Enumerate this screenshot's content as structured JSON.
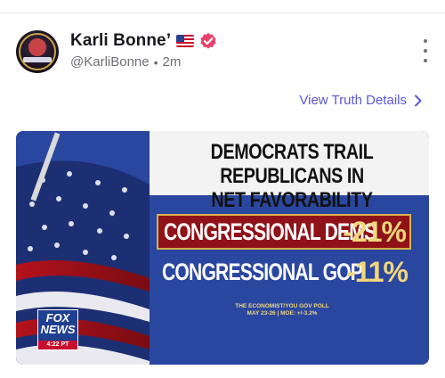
{
  "post": {
    "author_name": "Karli Bonne’",
    "handle": "@KarliBonne",
    "separator": "•",
    "timestamp": "2m",
    "details_link": "View Truth Details"
  },
  "graphic": {
    "headline_line1": "DEMOCRATS TRAIL REPUBLICANS IN",
    "headline_line2": "NET FAVORABILITY",
    "rows": [
      {
        "label": "CONGRESSIONAL DEMS",
        "value": "-21%"
      },
      {
        "label": "CONGRESSIONAL GOP",
        "value": "-11%"
      }
    ],
    "source_line1": "THE ECONOMIST/YOU GOV POLL",
    "source_line2": "MAY 23-26 | MOE: +/-3.2%",
    "network_line1": "FOX",
    "network_line2": "NEWS",
    "network_time": "4:22 PT"
  },
  "colors": {
    "link": "#5b58d6",
    "verified_badge": "#e8436b",
    "dems_bar": "#8f1218",
    "value_gold": "#f2d77a"
  },
  "icons": {
    "flag": "us-flag-emoji",
    "verified": "verified-badge-icon",
    "more": "kebab-menu-icon",
    "chevron": "chevron-right-icon"
  }
}
